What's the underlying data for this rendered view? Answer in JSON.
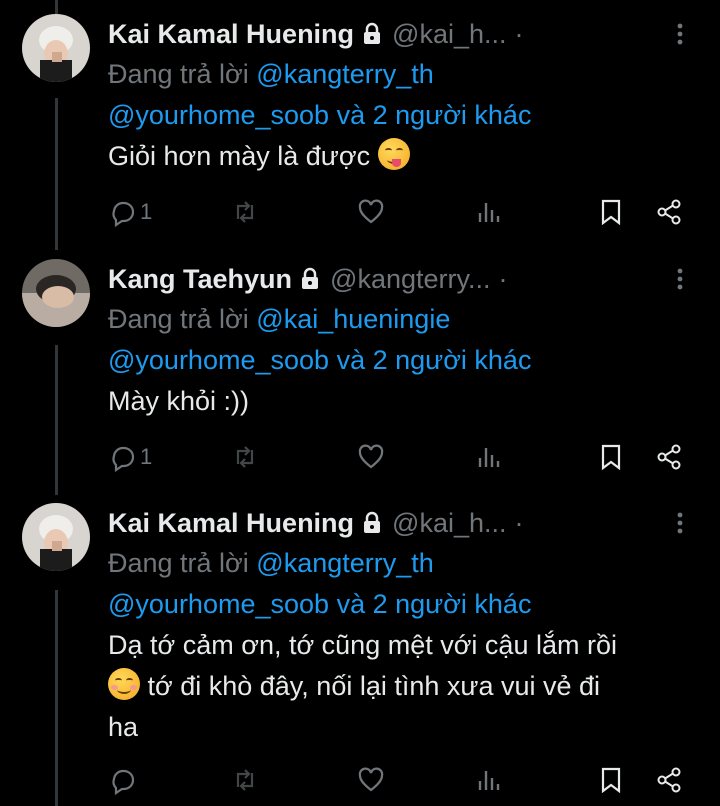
{
  "tweets": [
    {
      "name": "Kai Kamal Huening",
      "handle": "@kai_h...",
      "dot": "·",
      "reply_prefix": "Đang trả lời",
      "reply_to": "@kangterry_th",
      "reply_others_mention": "@yourhome_soob",
      "reply_others_rest": "và 2 người khác",
      "text": "Giỏi hơn mày là được",
      "text_after_emoji": "",
      "emoji": "yum-face",
      "reply_count": "1"
    },
    {
      "name": "Kang Taehyun",
      "handle": "@kangterry...",
      "dot": "·",
      "reply_prefix": "Đang trả lời",
      "reply_to": "@kai_hueningie",
      "reply_others_mention": "@yourhome_soob",
      "reply_others_rest": "và 2 người khác",
      "text": "Mày khỏi :))",
      "reply_count": "1"
    },
    {
      "name": "Kai Kamal Huening",
      "handle": "@kai_h...",
      "dot": "·",
      "reply_prefix": "Đang trả lời",
      "reply_to": "@kangterry_th",
      "reply_others_mention": "@yourhome_soob",
      "reply_others_rest": "và 2 người khác",
      "text_line1": "Dạ tớ cảm ơn, tớ cũng mệt với cậu lắm rồi",
      "text_line2": "tớ đi khò đây, nối lại tình xưa vui vẻ đi",
      "text_line3": "ha",
      "emoji": "smiling-face-with-blush",
      "reply_count": ""
    }
  ],
  "icons": [
    "lock-icon",
    "more-icon",
    "reply-icon",
    "retweet-icon",
    "like-icon",
    "views-icon",
    "bookmark-icon",
    "share-icon"
  ],
  "colors": {
    "background": "#000000",
    "text": "#e7e9ea",
    "muted": "#71767b",
    "accent": "#1d9bf0"
  }
}
